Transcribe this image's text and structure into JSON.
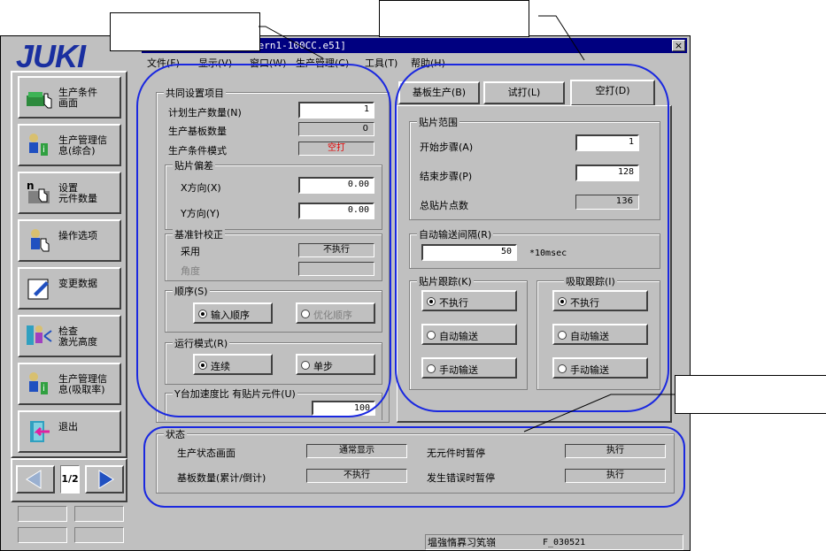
{
  "window": {
    "title": "tern1-100CC.e51]",
    "close_label": "×"
  },
  "logo": "JUKI",
  "menu": [
    "文件(F)",
    "显示(V)",
    "窗口(W)",
    "生产管理(C)",
    "工具(T)",
    "帮助(H)"
  ],
  "sidebar": {
    "items": [
      {
        "label": "生产条件\n画面",
        "icon": "production-condition-icon"
      },
      {
        "label": "生产管理信\n息(综合)",
        "icon": "production-info-icon"
      },
      {
        "label": "设置\n元件数量",
        "icon": "component-count-icon"
      },
      {
        "label": "操作选项",
        "icon": "operation-option-icon"
      },
      {
        "label": "变更数据",
        "icon": "edit-data-icon"
      },
      {
        "label": "检查\n激光高度",
        "icon": "laser-check-icon"
      },
      {
        "label": "生产管理信\n息(吸取率)",
        "icon": "pickup-rate-icon"
      },
      {
        "label": "退出",
        "icon": "exit-icon"
      }
    ],
    "page_indicator": "1/2"
  },
  "common": {
    "title": "共同设置项目",
    "plan_qty_label": "计划生产数量(N)",
    "plan_qty_value": "1",
    "production_boards_label": "生产基板数量",
    "production_boards_value": "0",
    "mode_label": "生产条件模式",
    "mode_value": "空打",
    "offset": {
      "title": "贴片偏差",
      "x_label": "X方向(X)",
      "x_value": "0.00",
      "y_label": "Y方向(Y)",
      "y_value": "0.00"
    },
    "calibration": {
      "title": "基准针校正",
      "adopt_label": "采用",
      "adopt_value": "不执行",
      "angle_label": "角度",
      "angle_value": ""
    },
    "order": {
      "title": "顺序(S)",
      "option1": "输入顺序",
      "option2": "优化顺序"
    },
    "run_mode": {
      "title": "运行模式(R)",
      "option1": "连续",
      "option2": "单步"
    },
    "speed": {
      "title": "Y台加速度比 有贴片元件(U)",
      "value": "100"
    }
  },
  "tabs": [
    "基板生产(B)",
    "试打(L)",
    "空打(D)"
  ],
  "range": {
    "title": "贴片范围",
    "start_label": "开始步骤(A)",
    "start_value": "1",
    "end_label": "结束步骤(P)",
    "end_value": "128",
    "total_label": "总贴片点数",
    "total_value": "136"
  },
  "interval": {
    "title": "自动输送间隔(R)",
    "value": "50",
    "unit": "*10msec"
  },
  "tracking": {
    "title": "贴片跟踪(K)",
    "options": [
      "不执行",
      "自动输送",
      "手动输送"
    ]
  },
  "pickup": {
    "title": "吸取跟踪(I)",
    "options": [
      "不执行",
      "自动输送",
      "手动输送"
    ]
  },
  "status": {
    "title": "状态",
    "screen_label": "生产状态画面",
    "screen_value": "通常显示",
    "count_label": "基板数量(累计/倒计)",
    "count_value": "不执行",
    "nocomp_label": "无元件时暂停",
    "nocomp_value": "执行",
    "error_label": "发生错误时暂停",
    "error_value": "执行"
  },
  "statusbar": {
    "text": "塭強惰奡习笂嶺",
    "code": "F_030521"
  },
  "colors": {
    "accent": "#1a28e0",
    "logo": "#1a2fa0",
    "warn": "#e00000",
    "titlebar": "#000080"
  }
}
